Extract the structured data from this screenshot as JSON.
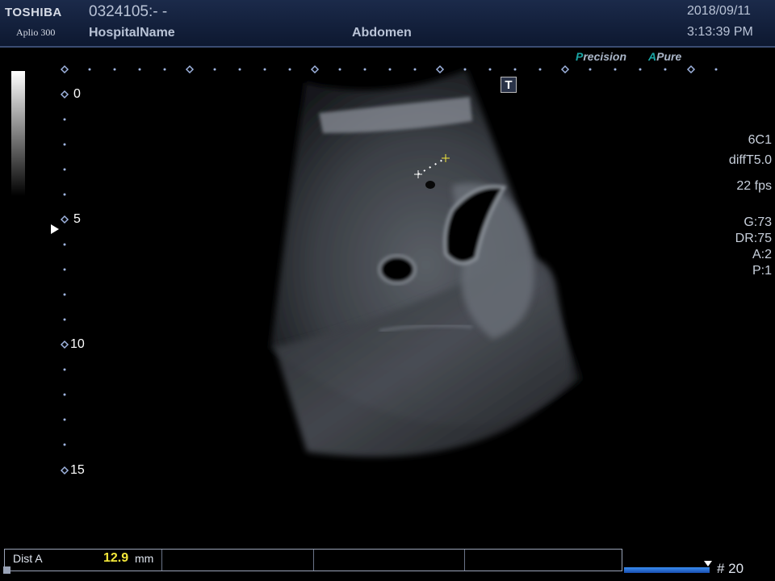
{
  "header": {
    "brand": "TOSHIBA",
    "model": "Aplio 300",
    "patient_id": "0324105:- -",
    "hospital": "HospitalName",
    "exam": "Abdomen",
    "date": "2018/09/11",
    "time": "3:13:39 PM"
  },
  "image_processing": {
    "precision_first": "P",
    "precision_rest": "recision",
    "apure_first": "A",
    "apure_rest": "Pure"
  },
  "depth_scale": {
    "labels": [
      "0",
      "5",
      "10",
      "15"
    ]
  },
  "t_icon_label": "T",
  "params": {
    "probe": "6C1",
    "mode": "diffT5.0",
    "fps": "22 fps",
    "gain": "G:73",
    "dynamic_range": "DR:75",
    "a": "A:2",
    "p": "P:1"
  },
  "measurement": {
    "label": "Dist A",
    "value": "12.9",
    "unit": "mm"
  },
  "cine": {
    "frame": "# 20"
  },
  "colors": {
    "header_bg": "#1b2a4a",
    "accent_teal": "#1aa6a6",
    "measure_value": "#f4e83a",
    "cine_blue": "#3a8ef0"
  }
}
